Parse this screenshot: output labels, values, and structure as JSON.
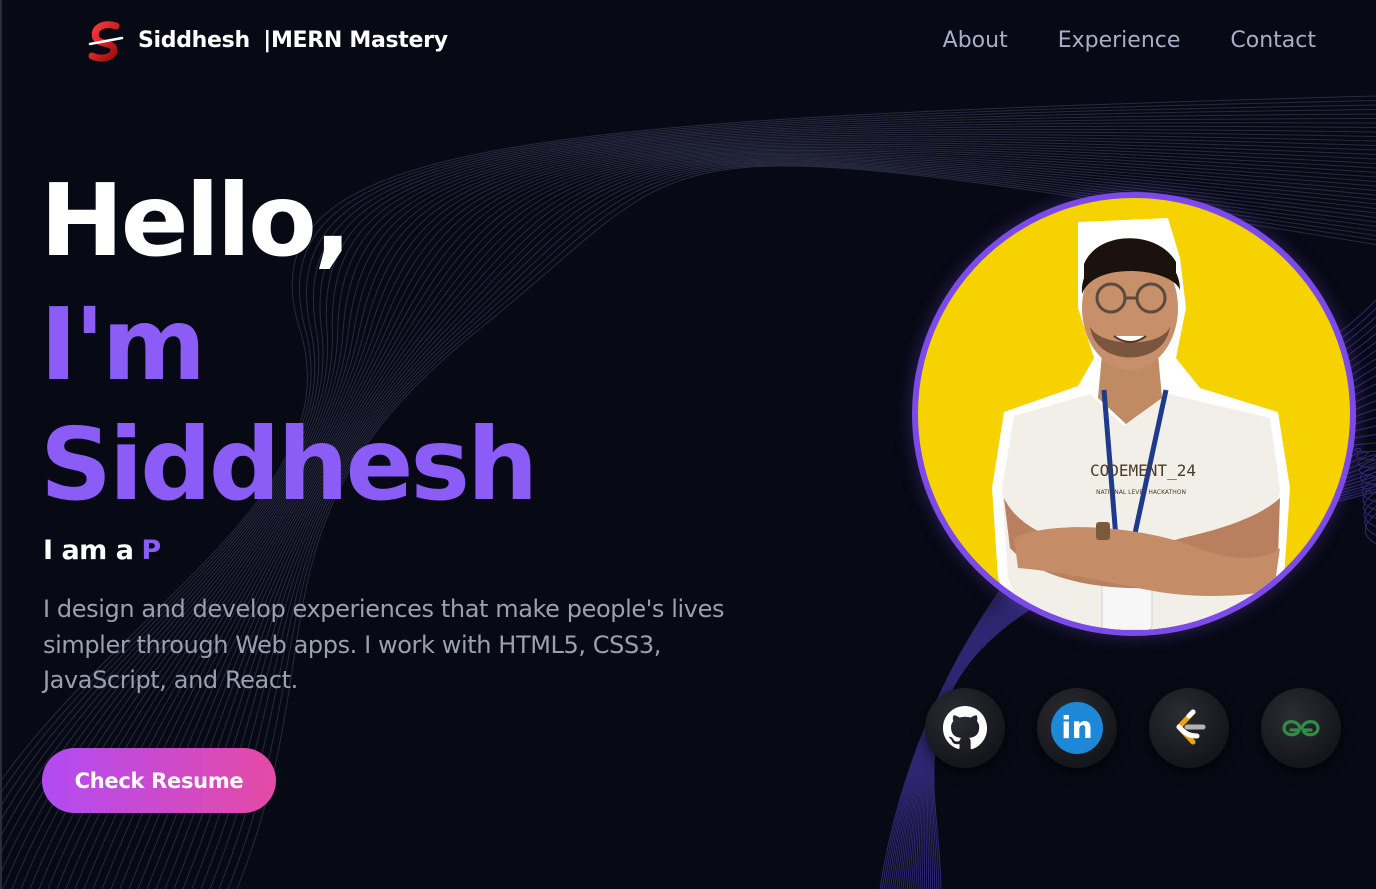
{
  "navbar": {
    "brand_name": "Siddhesh",
    "brand_separator": "|",
    "brand_tagline": "MERN Mastery",
    "links": [
      {
        "label": "About"
      },
      {
        "label": "Experience"
      },
      {
        "label": "Contact"
      }
    ]
  },
  "hero": {
    "greeting": "Hello,",
    "im": "I'm",
    "name": "Siddhesh",
    "role_prefix": "I am a",
    "role_typed": "P",
    "intro": "I design and develop experiences that make people's lives simpler through Web apps. I work with HTML5, CSS3, JavaScript, and React.",
    "resume_button": "Check Resume"
  },
  "profile": {
    "badge_text": "CODEMENT_24",
    "badge_subtext": "NATIONAL LEVEL HACKATHON"
  },
  "social": [
    {
      "icon": "github-icon"
    },
    {
      "icon": "linkedin-icon",
      "label": "in"
    },
    {
      "icon": "leetcode-icon"
    },
    {
      "icon": "geeksforgeeks-icon"
    }
  ],
  "colors": {
    "background": "#070914",
    "accent_purple": "#8b5cf6",
    "nav_text": "#a9adc7",
    "body_text": "#9aa0ad",
    "button_gradient_start": "#b14bf4",
    "button_gradient_end": "#e54aa5",
    "profile_bg": "#f6d200",
    "profile_ring": "#7b4ae8"
  }
}
